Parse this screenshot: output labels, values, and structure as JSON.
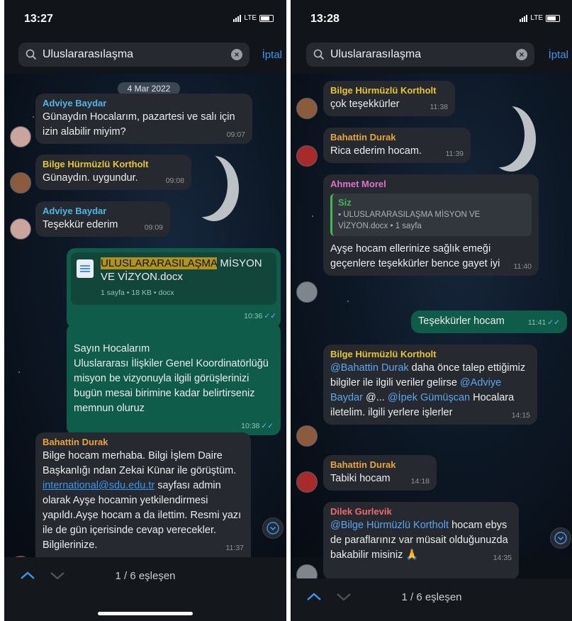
{
  "colors": {
    "accent": "#3a97f0",
    "outgoing_bubble": "#0f5c4b",
    "incoming_bubble": "#262a30",
    "highlight": "#b09317"
  },
  "left": {
    "time": "13:27",
    "network": "LTE",
    "search": {
      "query": "Uluslararasılaşma",
      "cancel": "İptal"
    },
    "date_chip": "4 Mar 2022",
    "msg1": {
      "sender": "Adviye Baydar",
      "text": "Günaydın Hocalarım, pazartesi ve salı için izin alabilir miyim?",
      "time": "09:07"
    },
    "msg2": {
      "sender": "Bilge Hürmüzlü Kortholt",
      "text": "Günaydın. uygundur.",
      "time": "09:08"
    },
    "msg3": {
      "sender": "Adviye Baydar",
      "text": "Teşekkür ederim",
      "time": "09:09"
    },
    "file": {
      "name_highlight": "ULUSLARARASILAŞMA",
      "name_rest": " MİSYON VE VİZYON.docx",
      "info": "1 sayfa • 18 KB • docx",
      "time": "10:36"
    },
    "msg5": {
      "text": "Sayın Hocalarım\nUluslararası İlişkiler Genel Koordinatörlüğü misyon be vizyonuyla ilgili görüşlerinizi bugün mesai birimine kadar belirtirseniz memnun oluruz",
      "time": "10:38"
    },
    "msg6": {
      "sender": "Bahattin Durak",
      "text_before": "Bilge hocam merhaba. Bilgi İşlem Daire Başkanlığı ndan Zekai Künar ile görüştüm. ",
      "link": "international@sdu.edu.tr",
      "text_after": " sayfası admin olarak Ayşe hocamin yetkilendirmesi yapıldı.Ayşe hocam a da ilettim. Resmi yazı ile de gün içerisinde cevap verecekler. Bilgilerinize.",
      "time": "11:37"
    },
    "counter": "1 / 6 eşleşen"
  },
  "right": {
    "time": "13:28",
    "network": "LTE",
    "search": {
      "query": "Uluslararasılaşma",
      "cancel": "İptal"
    },
    "msg1": {
      "sender": "Bilge Hürmüzlü Kortholt",
      "text": "çok teşekkürler",
      "time": "11:38"
    },
    "msg2": {
      "sender": "Bahattin Durak",
      "text": "Rica ederim hocam.",
      "time": "11:39"
    },
    "msg3": {
      "sender": "Ahmet Morel",
      "reply_name": "Siz",
      "reply_text": "ULUSLARARASILAŞMA MİSYON VE VİZYON.docx • 1 sayfa",
      "text": "Ayşe hocam ellerinize sağlık emeği geçenlere teşekkürler bence gayet iyi",
      "time": "11:40"
    },
    "msg4": {
      "text": "Teşekkürler hocam",
      "time": "11:41"
    },
    "msg5": {
      "sender": "Bilge Hürmüzlü Kortholt",
      "mention1": "@Bahattin Durak",
      "text1": " daha önce talep ettiğimiz bilgiler ile ilgili veriler gelirse ",
      "mention2": "@Adviye Baydar",
      "text2": " @... ",
      "mention3": "@İpek Gümüşcan",
      "text3": " Hocalara iletelim. ilgili yerlere işlerler",
      "time": "14:15"
    },
    "msg6": {
      "sender": "Bahattin Durak",
      "text": "Tabiki hocam",
      "time": "14:18"
    },
    "msg7": {
      "sender": "Dilek Gurlevik",
      "mention": "@Bilge Hürmüzlü Kortholt",
      "text": " hocam ebys de paraflarınız var müsait olduğunuzda bakabilir misiniz 🙏",
      "time": "14:35"
    },
    "counter": "1 / 6 eşleşen"
  }
}
